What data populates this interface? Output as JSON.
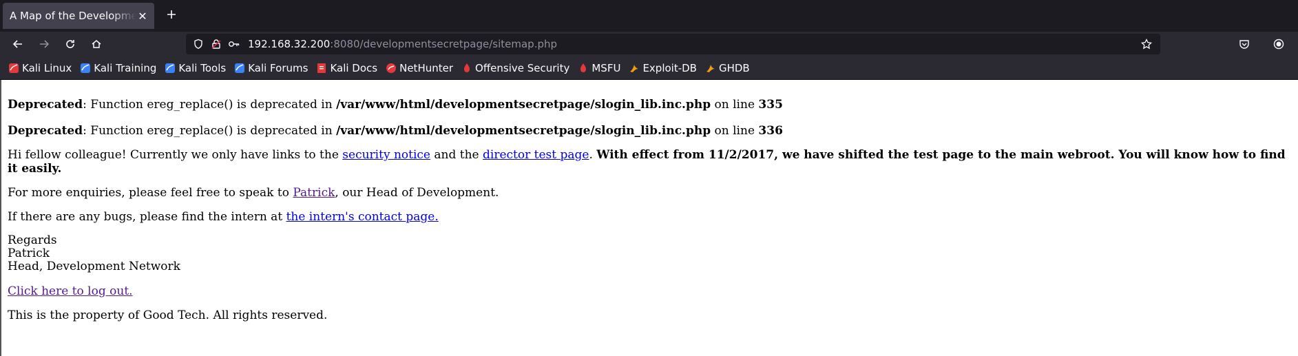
{
  "browser": {
    "tab": {
      "title": "A Map of the Development Network"
    },
    "url": {
      "host": "192.168.32.200",
      "rest": ":8080/developmentsecretpage/sitemap.php"
    },
    "bookmarks": [
      {
        "label": "Kali Linux",
        "icon": "kali-icon",
        "color": "#e5383b"
      },
      {
        "label": "Kali Training",
        "icon": "kali-training-icon",
        "color": "#3b82f6"
      },
      {
        "label": "Kali Tools",
        "icon": "kali-tools-icon",
        "color": "#3b82f6"
      },
      {
        "label": "Kali Forums",
        "icon": "kali-forums-icon",
        "color": "#3b82f6"
      },
      {
        "label": "Kali Docs",
        "icon": "kali-docs-icon",
        "color": "#e5383b"
      },
      {
        "label": "NetHunter",
        "icon": "nethunter-icon",
        "color": "#e5383b"
      },
      {
        "label": "Offensive Security",
        "icon": "offsec-icon",
        "color": "#e5383b"
      },
      {
        "label": "MSFU",
        "icon": "msfu-icon",
        "color": "#e5383b"
      },
      {
        "label": "Exploit-DB",
        "icon": "exploitdb-icon",
        "color": "#f59e0b"
      },
      {
        "label": "GHDB",
        "icon": "ghdb-icon",
        "color": "#f59e0b"
      }
    ]
  },
  "page": {
    "deprecated": [
      {
        "label": "Deprecated",
        "text": ": Function ereg_replace() is deprecated in ",
        "path": "/var/www/html/developmentsecretpage/slogin_lib.inc.php",
        "on_line": " on line ",
        "line": "335"
      },
      {
        "label": "Deprecated",
        "text": ": Function ereg_replace() is deprecated in ",
        "path": "/var/www/html/developmentsecretpage/slogin_lib.inc.php",
        "on_line": " on line ",
        "line": "336"
      }
    ],
    "intro": {
      "before": "Hi fellow colleague! Currently we only have links to the ",
      "link1": "security notice",
      "middle": " and the ",
      "link2": "director test page",
      "dot": ". ",
      "bold": "With effect from 11/2/2017, we have shifted the test page to the main webroot. You will know how to find it easily."
    },
    "enquiries": {
      "before": "For more enquiries, please feel free to speak to ",
      "link": "Patrick",
      "after": ", our Head of Development."
    },
    "bugs": {
      "before": "If there are any bugs, please find the intern at ",
      "link": "the intern's contact page."
    },
    "regards": [
      "Regards",
      "Patrick",
      "Head, Development Network"
    ],
    "logout": "Click here to log out.",
    "footer": "This is the property of Good Tech. All rights reserved."
  }
}
